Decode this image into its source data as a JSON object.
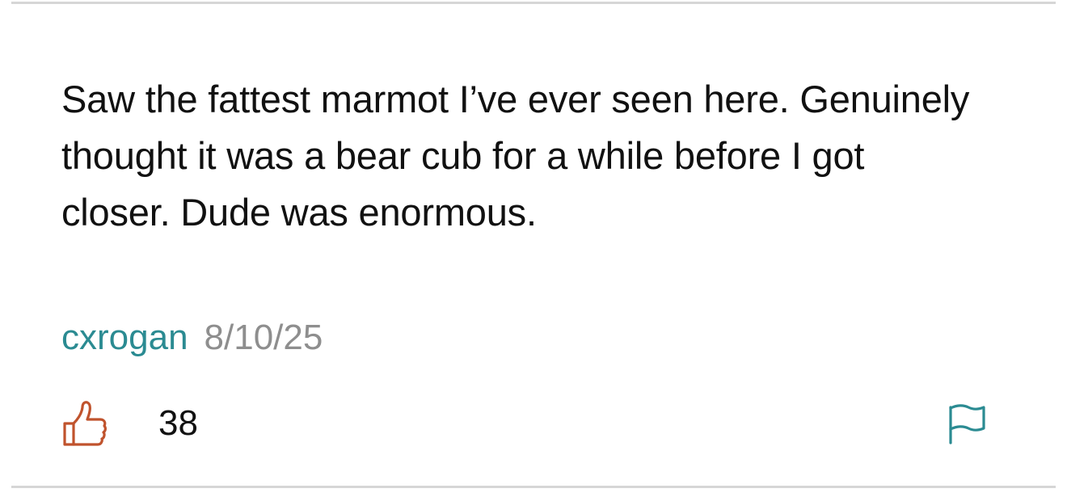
{
  "comment": {
    "text": "Saw the fattest marmot I’ve ever seen here. Genuinely thought it was a bear cub for a while before I got closer. Dude was enormous.",
    "author": "cxrogan",
    "date": "8/10/25"
  },
  "actions": {
    "like_icon": "thumbs-up-icon",
    "like_count": "38",
    "flag_icon": "flag-icon"
  },
  "colors": {
    "author": "#2b8b92",
    "date": "#8e8e8e",
    "like_icon": "#c0532d",
    "flag_icon": "#2b8b92",
    "divider": "#d6d6d6"
  }
}
